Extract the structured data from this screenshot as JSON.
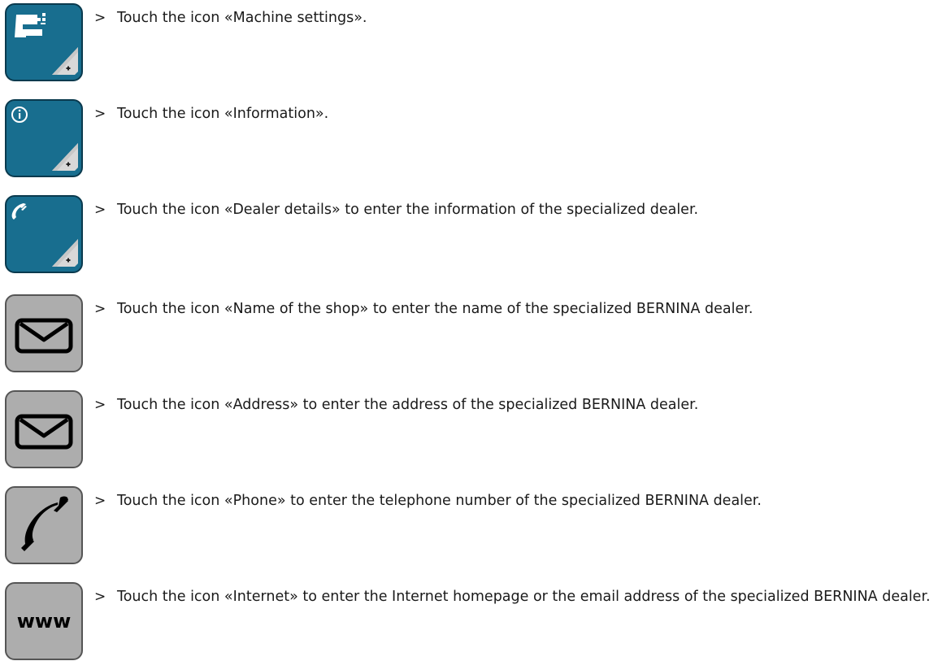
{
  "steps": [
    {
      "marker": ">",
      "text": "Touch the icon «Machine settings».",
      "icon": "machine-settings-icon"
    },
    {
      "marker": ">",
      "text": "Touch the icon «Information».",
      "icon": "information-icon"
    },
    {
      "marker": ">",
      "text": "Touch the icon «Dealer details» to enter the information of the specialized dealer.",
      "icon": "dealer-details-icon"
    },
    {
      "marker": ">",
      "text": "Touch the icon «Name of the shop» to enter the name of the specialized BERNINA dealer.",
      "icon": "envelope-icon"
    },
    {
      "marker": ">",
      "text": "Touch the icon «Address» to enter the address of the specialized BERNINA dealer.",
      "icon": "envelope-icon"
    },
    {
      "marker": ">",
      "text": "Touch the icon «Phone» to enter the telephone number of the specialized BERNINA dealer.",
      "icon": "phone-icon"
    },
    {
      "marker": ">",
      "text": "Touch the icon «Internet» to enter the Internet homepage or the email address of the specialized BERNINA dealer.",
      "icon": "www-icon",
      "icon_label": "www"
    }
  ],
  "colors": {
    "blue_button": "#186e8f",
    "gray_button": "#adadad",
    "text": "#1a1a1a"
  }
}
